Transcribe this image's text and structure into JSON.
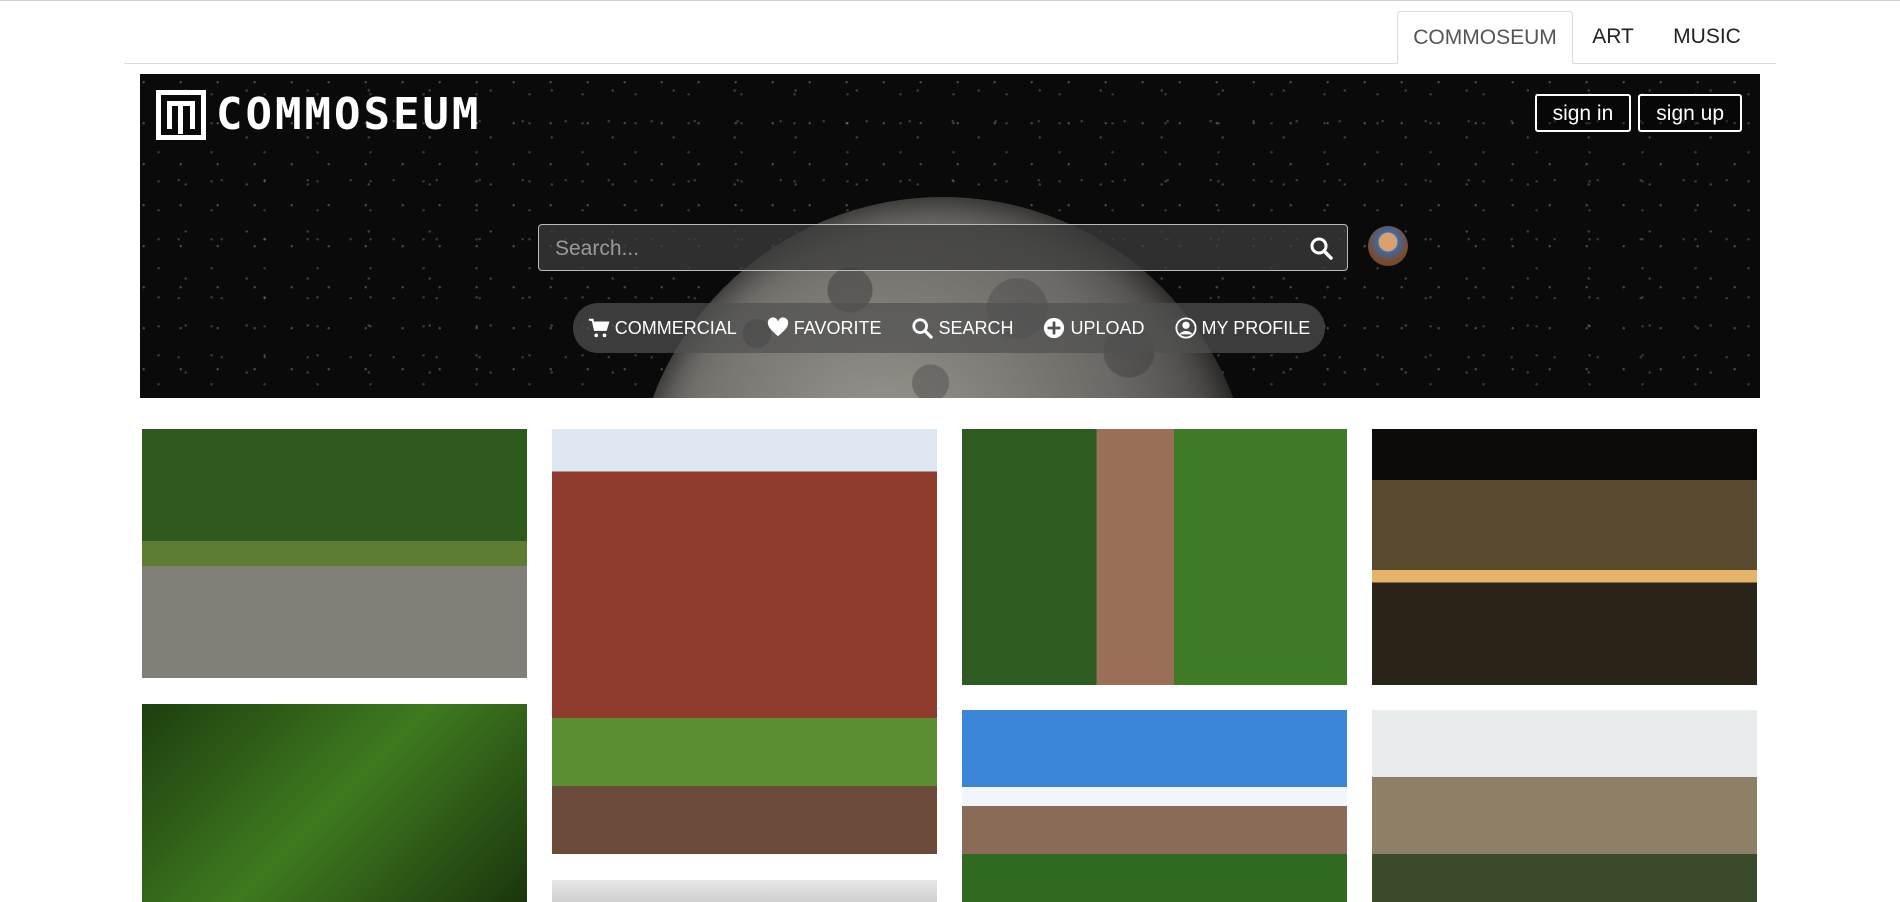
{
  "tabs": [
    {
      "label": "COMMOSEUM",
      "active": true
    },
    {
      "label": "ART",
      "active": false
    },
    {
      "label": "MUSIC",
      "active": false
    }
  ],
  "brand": {
    "logo_text": "COMMOSEUM"
  },
  "auth": {
    "sign_in": "sign in",
    "sign_up": "sign up"
  },
  "search": {
    "placeholder": "Search...",
    "icon": "search-icon"
  },
  "nav": [
    {
      "label": "COMMERCIAL",
      "icon": "cart-icon"
    },
    {
      "label": "FAVORITE",
      "icon": "heart-icon"
    },
    {
      "label": "SEARCH",
      "icon": "search-icon"
    },
    {
      "label": "UPLOAD",
      "icon": "plus-circle-icon"
    },
    {
      "label": "MY PROFILE",
      "icon": "user-circle-icon"
    }
  ],
  "gallery": {
    "photos": [
      "campus-avenue-trees",
      "red-brick-building",
      "courtyard-path",
      "building-at-night",
      "green-leaves",
      "partial-photo",
      "buildings-blue-sky",
      "stone-building-trees"
    ]
  },
  "colors": {
    "hero_bg": "#0a0a0a",
    "pill_bg": "#505050",
    "text_white": "#ffffff"
  }
}
